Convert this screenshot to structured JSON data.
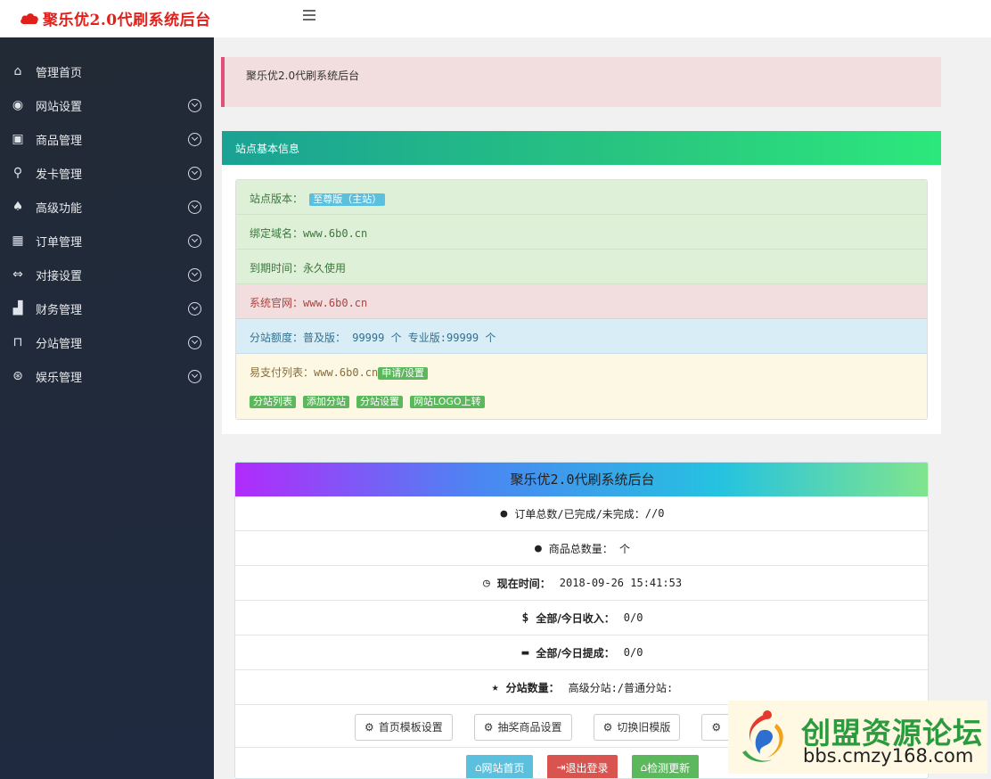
{
  "header": {
    "brand": "聚乐优2.0代刷系统后台"
  },
  "sidebar": {
    "items": [
      {
        "label": "管理首页",
        "icon": "home-icon",
        "glyph": "⌂"
      },
      {
        "label": "网站设置",
        "icon": "globe-icon",
        "glyph": "◉"
      },
      {
        "label": "商品管理",
        "icon": "bag-icon",
        "glyph": "▣"
      },
      {
        "label": "发卡管理",
        "icon": "search-key-icon",
        "glyph": "⚲"
      },
      {
        "label": "高级功能",
        "icon": "rocket-icon",
        "glyph": "♠"
      },
      {
        "label": "订单管理",
        "icon": "calendar-icon",
        "glyph": "▦"
      },
      {
        "label": "对接设置",
        "icon": "arrows-icon",
        "glyph": "⇔"
      },
      {
        "label": "财务管理",
        "icon": "chart-icon",
        "glyph": "▟"
      },
      {
        "label": "分站管理",
        "icon": "door-icon",
        "glyph": "⊓"
      },
      {
        "label": "娱乐管理",
        "icon": "dice-icon",
        "glyph": "⊛"
      }
    ]
  },
  "notice": {
    "text": "聚乐优2.0代刷系统后台"
  },
  "site_info": {
    "title": "站点基本信息",
    "version_label": "站点版本：",
    "version_tag": "至尊版（主站）",
    "domain": "绑定域名：www.6b0.cn",
    "expire": "到期时间：永久使用",
    "official": "系统官网：www.6b0.cn",
    "quota": "分站额度：普及版： 99999 个 专业版:99999 个",
    "pay_label": "易支付列表：www.6b0.cn",
    "pay_tag": "申请/设置",
    "tags": [
      "分站列表",
      "添加分站",
      "分站设置",
      "网站LOGO上转"
    ]
  },
  "stats": {
    "title": "聚乐优2.0代刷系统后台",
    "orders": {
      "icon": "drop-icon",
      "glyph": "💧",
      "label": "订单总数/已完成/未完成：",
      "value": "//0"
    },
    "goods": {
      "icon": "drop-icon",
      "glyph": "💧",
      "label": "商品总数量：",
      "value": "个"
    },
    "time": {
      "icon": "clock-icon",
      "glyph": "◷",
      "label": "现在时间：",
      "value": "2018-09-26 15:41:53"
    },
    "income": {
      "icon": "dollar-icon",
      "glyph": "$",
      "label": "全部/今日收入：",
      "value": "0/0"
    },
    "withdraw": {
      "icon": "card-icon",
      "glyph": "▬",
      "label": "全部/今日提成：",
      "value": "0/0"
    },
    "substations": {
      "icon": "star-icon",
      "glyph": "★",
      "label": "分站数量：",
      "value": "高级分站:/普通分站:"
    },
    "buttons": [
      "首页模板设置",
      "抽奖商品设置",
      "切换旧模版",
      ""
    ],
    "actions": [
      "网站首页",
      "退出登录",
      "检测更新"
    ]
  },
  "watermark": {
    "title": "创盟资源论坛",
    "url": "bbs.cmzy168.com"
  }
}
